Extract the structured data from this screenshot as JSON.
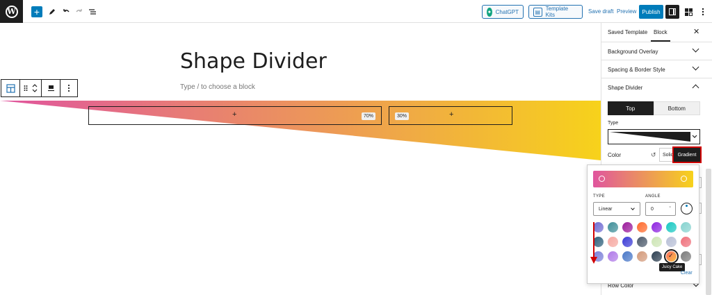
{
  "topbar": {
    "chatgpt_label": "ChatGPT",
    "template_kits_label": "Template Kits",
    "save_draft_label": "Save draft",
    "preview_label": "Preview",
    "publish_label": "Publish"
  },
  "canvas": {
    "title": "Shape Divider",
    "placeholder": "Type / to choose a block",
    "columns": [
      {
        "percent_label": "70%"
      },
      {
        "percent_label": "30%"
      }
    ],
    "gradient_colors": {
      "start": "#e0559e",
      "end": "#f7d21b"
    }
  },
  "sidebar": {
    "tabs": [
      "Saved Template",
      "Block"
    ],
    "panels": {
      "background_overlay": "Background Overlay",
      "spacing_border": "Spacing & Border Style",
      "shape_divider": "Shape Divider"
    },
    "toggle": {
      "top": "Top",
      "bottom": "Bottom"
    },
    "type_label": "Type",
    "color_label": "Color",
    "solid_label": "Solid",
    "gradient_label": "Gradient",
    "row_color_label": "Row Color"
  },
  "gradient_picker": {
    "type_label": "TYPE",
    "angle_label": "ANGLE",
    "type_value": "Linear",
    "angle_value": "0",
    "angle_unit": "°",
    "tooltip": "Juicy Cake",
    "clear_label": "Clear",
    "swatches": [
      [
        "#6f6bd2",
        "#3f8f99",
        "#9b1b9b",
        "#ff6b2d",
        "#8e24e0",
        "#18c8c2",
        "#86d3cf"
      ],
      [
        "#2e5f7a",
        "#f6a7a0",
        "#3b3bd6",
        "#4d5a6b",
        "#cde5b5",
        "#b7bfd6",
        "#ef6f7a"
      ],
      [
        "#7a7fd8",
        "#b07ae8",
        "#4a78c8",
        "#d39a7b",
        "#2c3e50",
        "#e04a67",
        "#7b7b7b"
      ]
    ],
    "selected_swatch": "Juicy Cake"
  },
  "colors": {
    "accent": "#007cba",
    "dark": "#1e1e1e",
    "highlight_red": "#d10000"
  }
}
